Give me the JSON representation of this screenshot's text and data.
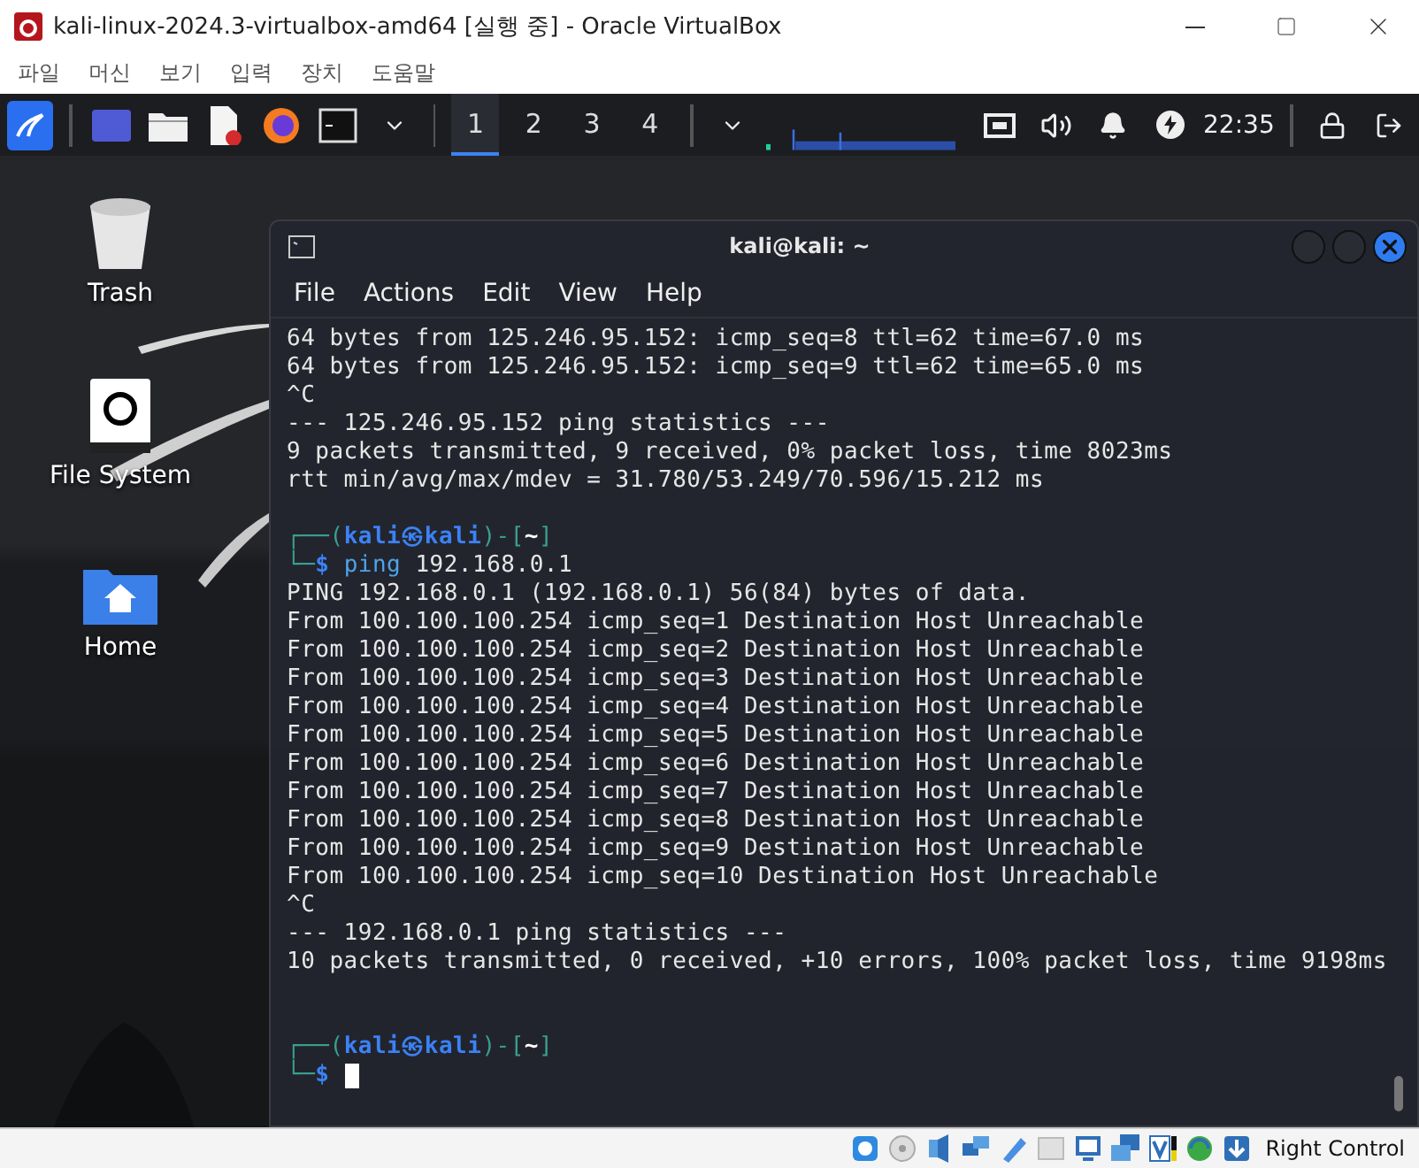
{
  "vbox_window": {
    "title": "kali-linux-2024.3-virtualbox-amd64 [실행 중] - Oracle VirtualBox",
    "menu": [
      "파일",
      "머신",
      "보기",
      "입력",
      "장치",
      "도움말"
    ]
  },
  "panel": {
    "workspaces": [
      {
        "label": "1",
        "selected": true
      },
      {
        "label": "2",
        "selected": false
      },
      {
        "label": "3",
        "selected": false
      },
      {
        "label": "4",
        "selected": false
      }
    ],
    "clock": "22:35"
  },
  "desktop_icons": [
    {
      "kind": "trash",
      "label": "Trash"
    },
    {
      "kind": "drive",
      "label": "File System"
    },
    {
      "kind": "home",
      "label": "Home"
    }
  ],
  "terminal": {
    "title": "kali@kali: ~",
    "menu": [
      "File",
      "Actions",
      "Edit",
      "View",
      "Help"
    ],
    "lines": [
      {
        "kind": "output",
        "text": "64 bytes from 125.246.95.152: icmp_seq=8 ttl=62 time=67.0 ms"
      },
      {
        "kind": "output",
        "text": "64 bytes from 125.246.95.152: icmp_seq=9 ttl=62 time=65.0 ms"
      },
      {
        "kind": "output",
        "text": "^C"
      },
      {
        "kind": "output",
        "text": "--- 125.246.95.152 ping statistics ---"
      },
      {
        "kind": "output",
        "text": "9 packets transmitted, 9 received, 0% packet loss, time 8023ms"
      },
      {
        "kind": "output",
        "text": "rtt min/avg/max/mdev = 31.780/53.249/70.596/15.212 ms"
      },
      {
        "kind": "blank"
      },
      {
        "kind": "prompt",
        "frame_top": "┌──(",
        "user": "kali",
        "at": "㉿",
        "host": "kali",
        "frame_mid": ")-[",
        "dir": "~",
        "frame_end": "]"
      },
      {
        "kind": "command",
        "frame": "└─",
        "symbol": "$",
        "command": "ping",
        "args": "192.168.0.1",
        "cursor": false
      },
      {
        "kind": "output",
        "text": "PING 192.168.0.1 (192.168.0.1) 56(84) bytes of data."
      },
      {
        "kind": "output",
        "text": "From 100.100.100.254 icmp_seq=1 Destination Host Unreachable"
      },
      {
        "kind": "output",
        "text": "From 100.100.100.254 icmp_seq=2 Destination Host Unreachable"
      },
      {
        "kind": "output",
        "text": "From 100.100.100.254 icmp_seq=3 Destination Host Unreachable"
      },
      {
        "kind": "output",
        "text": "From 100.100.100.254 icmp_seq=4 Destination Host Unreachable"
      },
      {
        "kind": "output",
        "text": "From 100.100.100.254 icmp_seq=5 Destination Host Unreachable"
      },
      {
        "kind": "output",
        "text": "From 100.100.100.254 icmp_seq=6 Destination Host Unreachable"
      },
      {
        "kind": "output",
        "text": "From 100.100.100.254 icmp_seq=7 Destination Host Unreachable"
      },
      {
        "kind": "output",
        "text": "From 100.100.100.254 icmp_seq=8 Destination Host Unreachable"
      },
      {
        "kind": "output",
        "text": "From 100.100.100.254 icmp_seq=9 Destination Host Unreachable"
      },
      {
        "kind": "output",
        "text": "From 100.100.100.254 icmp_seq=10 Destination Host Unreachable"
      },
      {
        "kind": "output",
        "text": "^C"
      },
      {
        "kind": "output",
        "text": "--- 192.168.0.1 ping statistics ---"
      },
      {
        "kind": "output",
        "text": "10 packets transmitted, 0 received, +10 errors, 100% packet loss, time 9198ms"
      },
      {
        "kind": "blank"
      },
      {
        "kind": "blank"
      },
      {
        "kind": "prompt",
        "frame_top": "┌──(",
        "user": "kali",
        "at": "㉿",
        "host": "kali",
        "frame_mid": ")-[",
        "dir": "~",
        "frame_end": "]"
      },
      {
        "kind": "command",
        "frame": "└─",
        "symbol": "$",
        "cursor": true
      }
    ]
  },
  "status_bar": {
    "host_key": "Right Control"
  }
}
